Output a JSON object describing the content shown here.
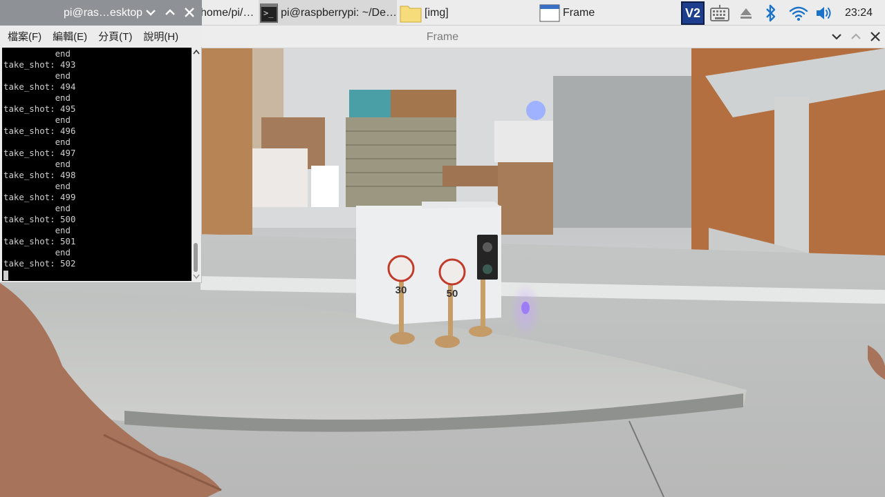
{
  "taskbar": {
    "tasks": [
      {
        "label": "home/pi/…"
      },
      {
        "label": "pi@raspberrypi: ~/De…"
      },
      {
        "label": "[img]"
      },
      {
        "label": "Frame"
      }
    ],
    "clock": "23:24",
    "tray_icons": [
      "vnc-icon",
      "keyboard-icon",
      "eject-icon",
      "bluetooth-icon",
      "wifi-icon",
      "volume-icon"
    ]
  },
  "terminal": {
    "title": "pi@ras…esktop",
    "menu": [
      "檔案(F)",
      "編輯(E)",
      "分頁(T)",
      "說明(H)"
    ],
    "lines": [
      "          end",
      "take_shot: 493",
      "          end",
      "take_shot: 494",
      "          end",
      "take_shot: 495",
      "          end",
      "take_shot: 496",
      "          end",
      "take_shot: 497",
      "          end",
      "take_shot: 498",
      "          end",
      "take_shot: 499",
      "          end",
      "take_shot: 500",
      "          end",
      "take_shot: 501",
      "          end",
      "take_shot: 502"
    ]
  },
  "frame": {
    "title": "Frame",
    "signs": [
      "30",
      "50"
    ]
  },
  "colors": {
    "terminal_titlebar": "#8e9196",
    "terminal_bg": "#000000",
    "terminal_fg": "#cfcfcf",
    "taskbar_bg": "#ececec",
    "vnc_blue": "#1d3e8c",
    "tray_blue": "#1a73c8"
  }
}
